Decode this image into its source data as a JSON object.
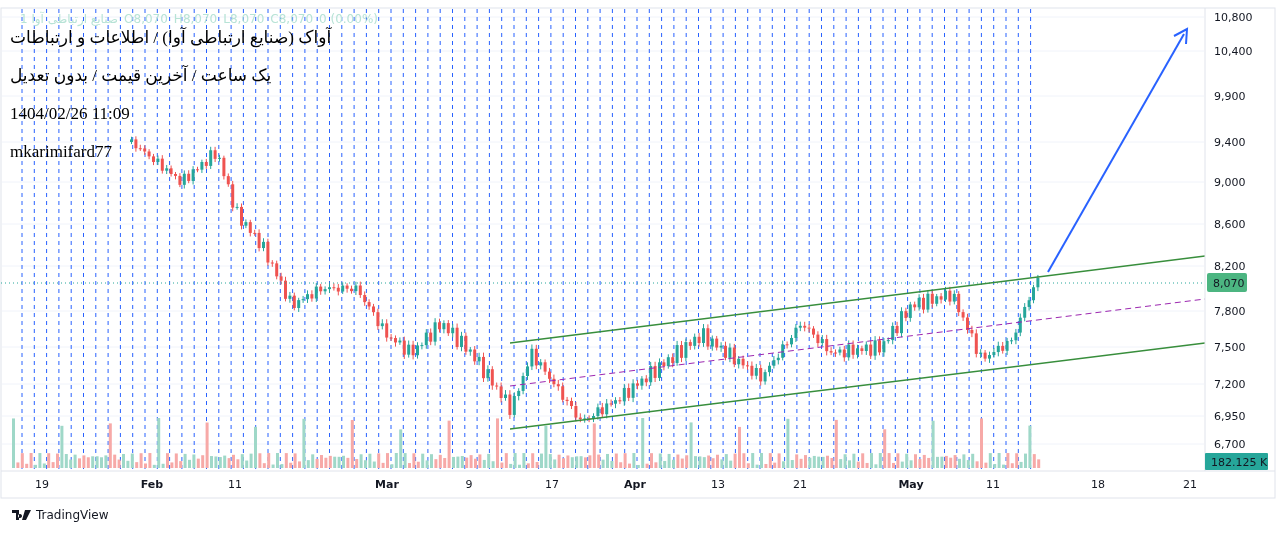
{
  "symbol_legend": {
    "name": "صنایع ارتباطی آوا",
    "interval": "1",
    "open": "O8,070",
    "high": "H8,070",
    "low": "L8,070",
    "close": "C8,070",
    "change": "0 (0.00%)"
  },
  "overlay_lines": [
    "آواک (صنایع ارتباطی آوا) / اطلاعات و ارتباطات",
    "یک ساعت / آخرین قیمت / بدون تعدیل",
    "1404/02/26 11:09",
    "mkarimifard77"
  ],
  "price_axis": {
    "labels": [
      "10,800",
      "10,400",
      "9,900",
      "9,400",
      "9,000",
      "8,600",
      "8,200",
      "7,800",
      "7,500",
      "7,200",
      "6,950",
      "6,700"
    ],
    "last_price": "8,070",
    "volume": "182.125 K"
  },
  "time_axis": {
    "labels": [
      {
        "text": "19",
        "bold": false
      },
      {
        "text": "Feb",
        "bold": true
      },
      {
        "text": "11",
        "bold": false
      },
      {
        "text": "Mar",
        "bold": true
      },
      {
        "text": "9",
        "bold": false
      },
      {
        "text": "17",
        "bold": false
      },
      {
        "text": "Apr",
        "bold": true
      },
      {
        "text": "13",
        "bold": false
      },
      {
        "text": "21",
        "bold": false
      },
      {
        "text": "May",
        "bold": true
      },
      {
        "text": "11",
        "bold": false
      },
      {
        "text": "18",
        "bold": false
      },
      {
        "text": "21",
        "bold": false
      }
    ]
  },
  "footer": {
    "brand": "TradingView"
  }
}
